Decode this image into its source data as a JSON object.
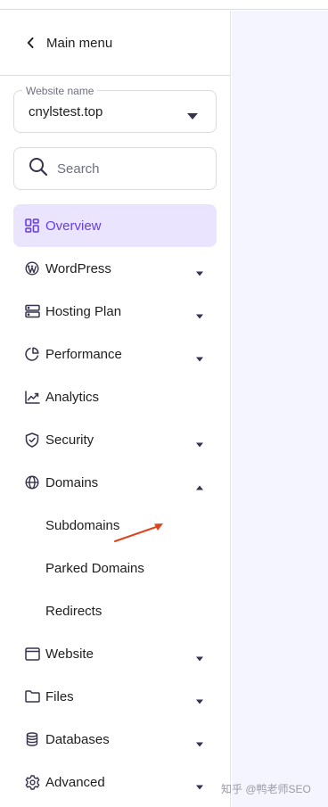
{
  "main_menu": {
    "label": "Main menu"
  },
  "website_select": {
    "legend": "Website name",
    "value": "cnylstest.top"
  },
  "search": {
    "placeholder": "Search"
  },
  "nav": {
    "overview": "Overview",
    "wordpress": "WordPress",
    "hosting_plan": "Hosting Plan",
    "performance": "Performance",
    "analytics": "Analytics",
    "security": "Security",
    "domains": "Domains",
    "subdomains": "Subdomains",
    "parked_domains": "Parked Domains",
    "redirects": "Redirects",
    "website": "Website",
    "files": "Files",
    "databases": "Databases",
    "advanced": "Advanced"
  },
  "colors": {
    "accent": "#673de6",
    "active_bg": "#ebe4ff",
    "annotation": "#e0441f"
  },
  "watermark": "知乎 @鸭老师SEO"
}
